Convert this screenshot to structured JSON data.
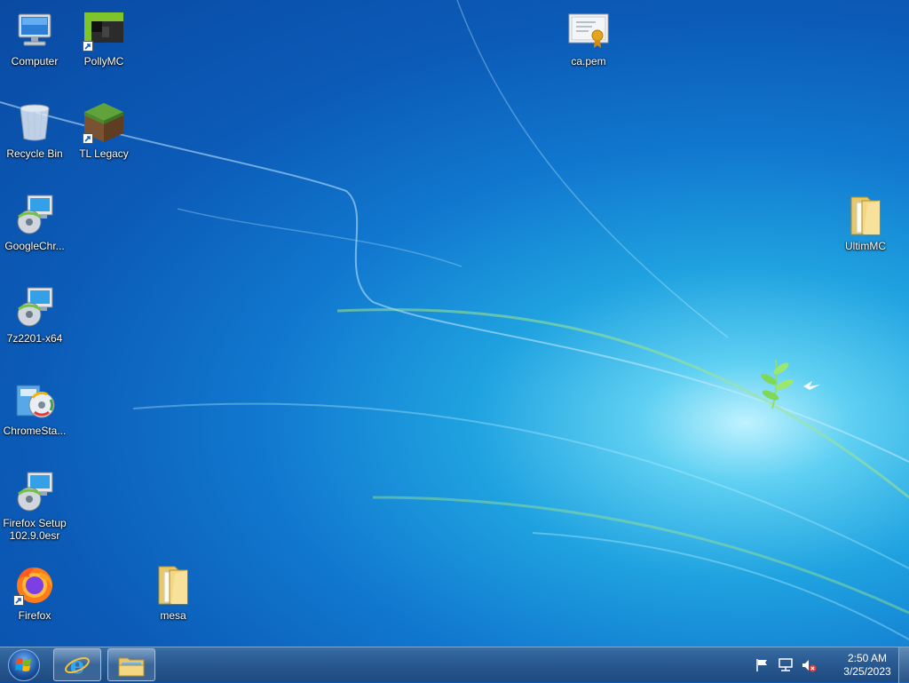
{
  "desktop": {
    "icons": [
      {
        "name": "Computer"
      },
      {
        "name": "PollyMC"
      },
      {
        "name": "ca.pem"
      },
      {
        "name": "Recycle Bin"
      },
      {
        "name": "TL Legacy"
      },
      {
        "name": "GoogleChr..."
      },
      {
        "name": "UltimMC"
      },
      {
        "name": "7z2201-x64"
      },
      {
        "name": "ChromeSta..."
      },
      {
        "name": "Firefox Setup 102.9.0esr"
      },
      {
        "name": "Firefox"
      },
      {
        "name": "mesa"
      }
    ]
  },
  "taskbar": {
    "pinned": [
      {
        "icon": "internet-explorer-icon"
      },
      {
        "icon": "file-explorer-icon"
      }
    ],
    "tray": {
      "icons": [
        "action-center-flag-icon",
        "network-icon",
        "volume-muted-icon"
      ]
    },
    "clock": {
      "time": "2:50 AM",
      "date": "3/25/2023"
    }
  },
  "colors": {
    "taskbar": "#2a5b93",
    "wallpaper_center": "#5fd0f2",
    "wallpaper_edge": "#0a4aa3"
  }
}
